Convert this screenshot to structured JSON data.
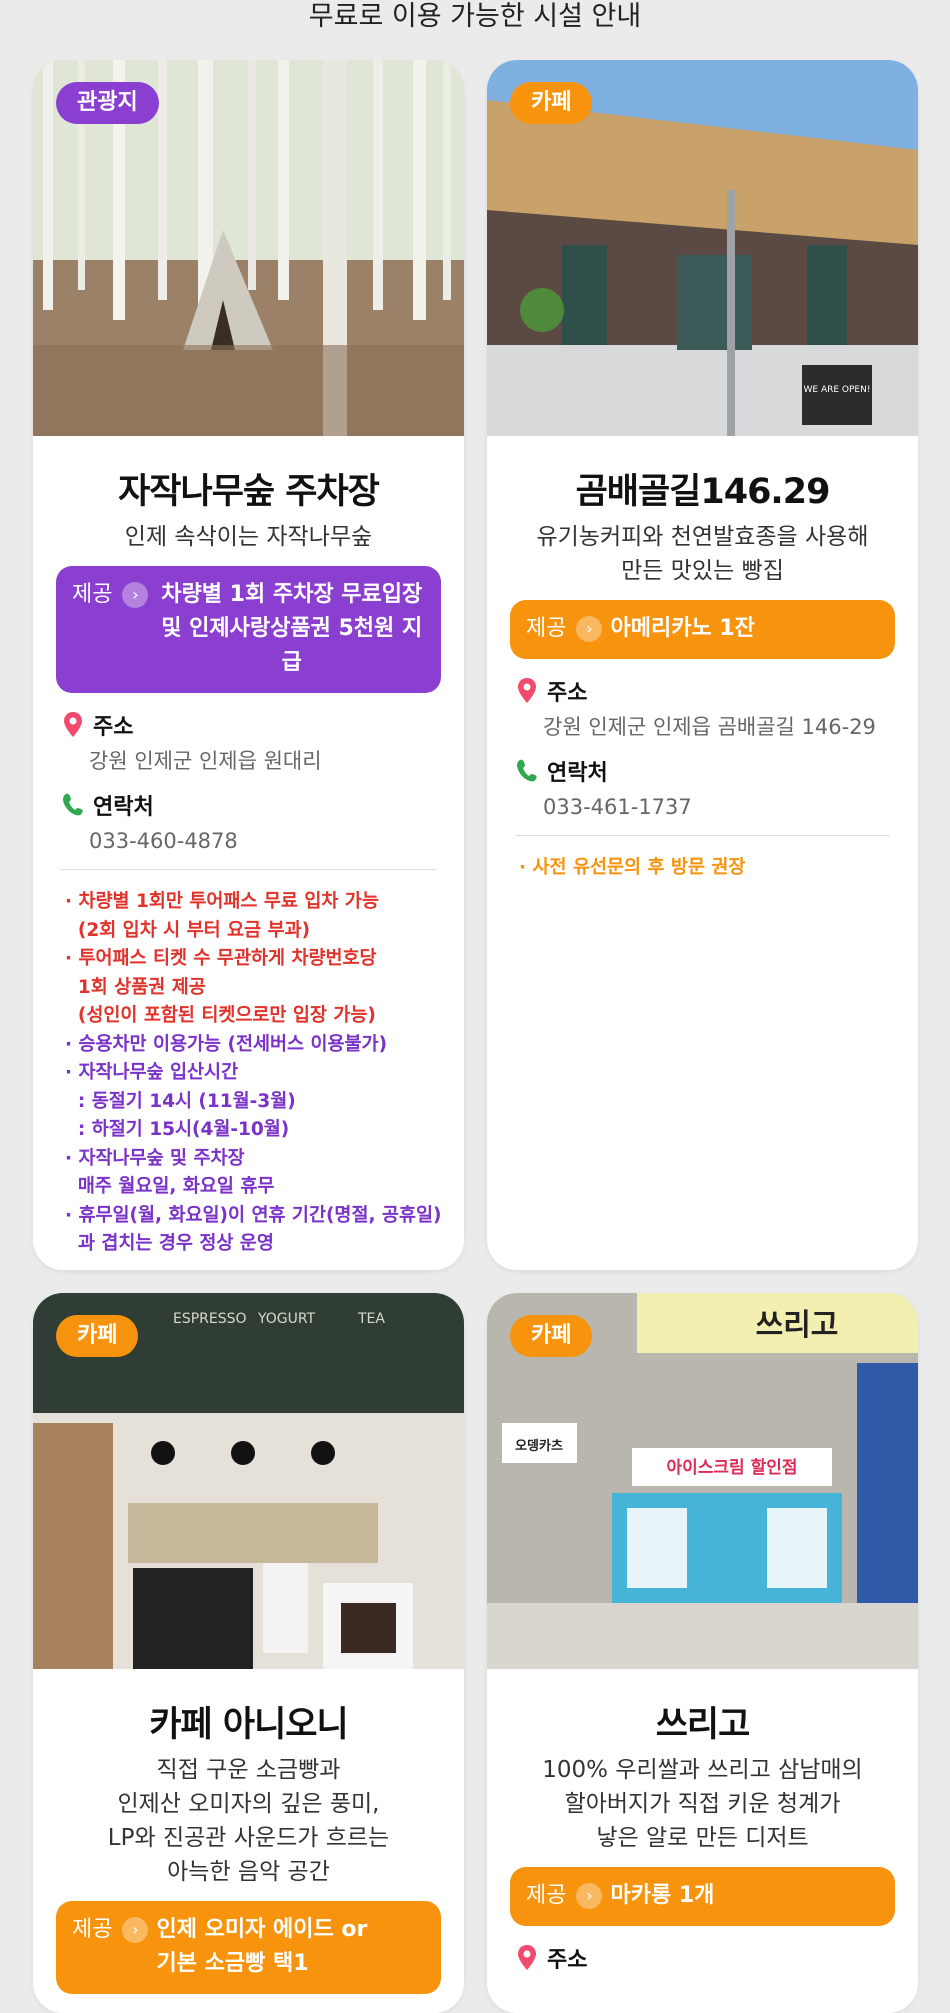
{
  "page": {
    "title": "무료로 이용 가능한 시설 안내"
  },
  "labels": {
    "offer": "제공",
    "address": "주소",
    "contact": "연락처"
  },
  "colors": {
    "purple": "#8a3fd1",
    "orange": "#f7930c",
    "red": "#e1322b"
  },
  "cards": [
    {
      "badge": "관광지",
      "name": "자작나무숲 주차장",
      "desc": [
        "인제 속삭이는 자작나무숲"
      ],
      "offer": [
        "차량별 1회 주차장 무료입장",
        "및 인제사랑상품권 5천원 지급"
      ],
      "address": "강원 인제군 인제읍 원대리",
      "phone": "033-460-4878",
      "notes_red": [
        "· 차량별 1회만 투어패스 무료 입차 가능",
        "  (2회 입차 시 부터 요금 부과)",
        "· 투어패스 티켓 수 무관하게 차량번호당",
        "  1회 상품권 제공",
        "  (성인이 포함된 티켓으로만 입장 가능)"
      ],
      "notes_purple": [
        "· 승용차만 이용가능 (전세버스 이용불가)",
        "· 자작나무숲 입산시간",
        "  : 동절기 14시 (11월-3월)",
        "  : 하절기 15시(4월-10월)",
        "· 자작나무숲 및 주차장",
        "  매주 월요일, 화요일 휴무",
        "· 휴무일(월, 화요일)이 연휴 기간(명절, 공휴일)",
        "  과 겹치는 경우 정상 운영"
      ]
    },
    {
      "badge": "카페",
      "name": "곰배골길146.29",
      "desc": [
        "유기농커피와 천연발효종을 사용해",
        "만든 맛있는 빵집"
      ],
      "offer": [
        "아메리카노 1잔"
      ],
      "address": "강원 인제군 인제읍 곰배골길 146-29",
      "phone": "033-461-1737",
      "notes_orange": [
        "· 사전 유선문의 후 방문 권장"
      ],
      "sign": "WE ARE OPEN!"
    },
    {
      "badge": "카페",
      "name": "카페 아니오니",
      "desc": [
        "직접 구운 소금빵과",
        "인제산 오미자의 깊은 풍미,",
        "LP와 진공관 사운드가 흐르는",
        "아늑한 음악 공간"
      ],
      "offer": [
        "인제 오미자 에이드 or",
        "기본 소금빵 택1"
      ],
      "board": [
        "ESPRESSO",
        "YOGURT",
        "TEA"
      ]
    },
    {
      "badge": "카페",
      "name": "쓰리고",
      "desc": [
        "100% 우리쌀과 쓰리고 삼남매의",
        "할아버지가 직접 키운 청계가",
        "낳은 알로 만든 디저트"
      ],
      "offer": [
        "마카롱 1개"
      ],
      "signs": [
        "쓰리고",
        "아이스크림 할인점",
        "오뎅카츠"
      ]
    }
  ]
}
